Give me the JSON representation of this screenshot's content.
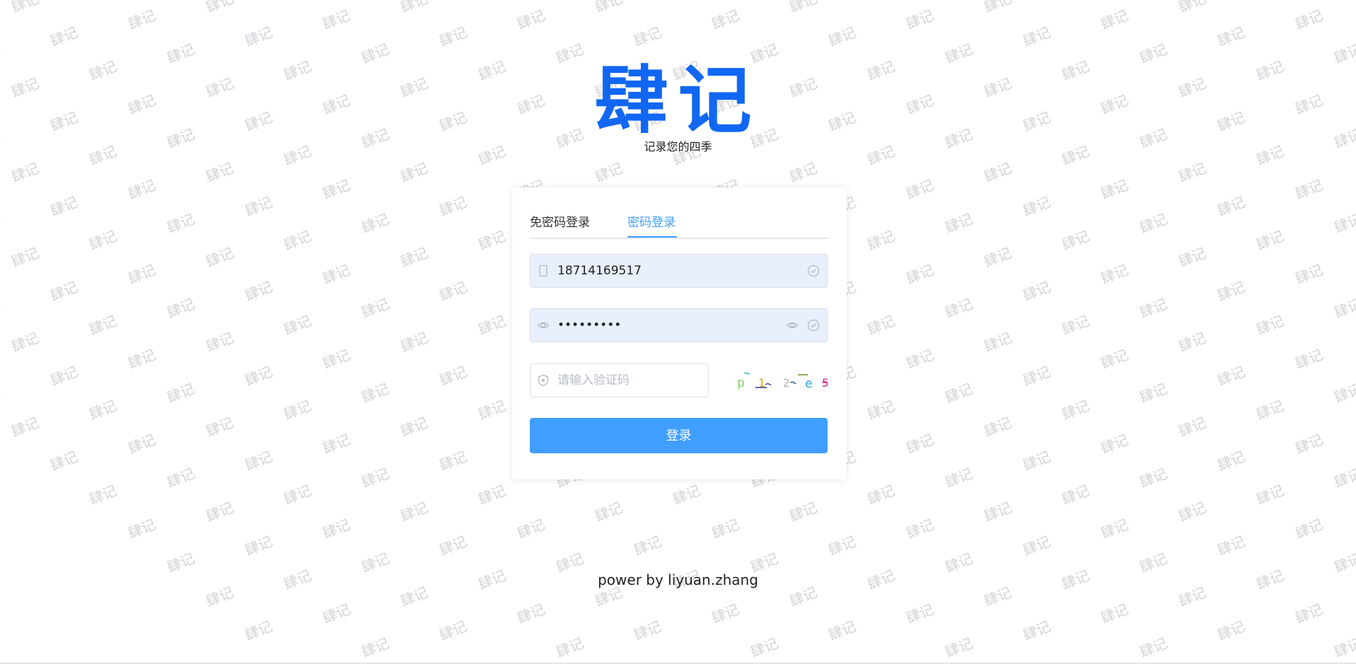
{
  "brand": {
    "logo_text": "肆记",
    "slogan": "记录您的四季",
    "accent_color": "#1167f2"
  },
  "watermark": {
    "text": "肆记"
  },
  "login": {
    "tabs": [
      {
        "label": "免密码登录",
        "active": false
      },
      {
        "label": "密码登录",
        "active": true
      }
    ],
    "phone": {
      "value": "18714169517",
      "icon": "mobile-icon",
      "status_icon": "check-circle-icon"
    },
    "password": {
      "value": "•••••••••",
      "icon": "eye-icon",
      "toggle_icon": "eye-icon",
      "status_icon": "check-circle-icon"
    },
    "captcha": {
      "placeholder": "请输入验证码",
      "icon": "shield-icon",
      "image_text": "p 1 2 e 5"
    },
    "submit_label": "登录",
    "submit_color": "#409eff"
  },
  "footer": {
    "text": "power by liyuan.zhang"
  }
}
